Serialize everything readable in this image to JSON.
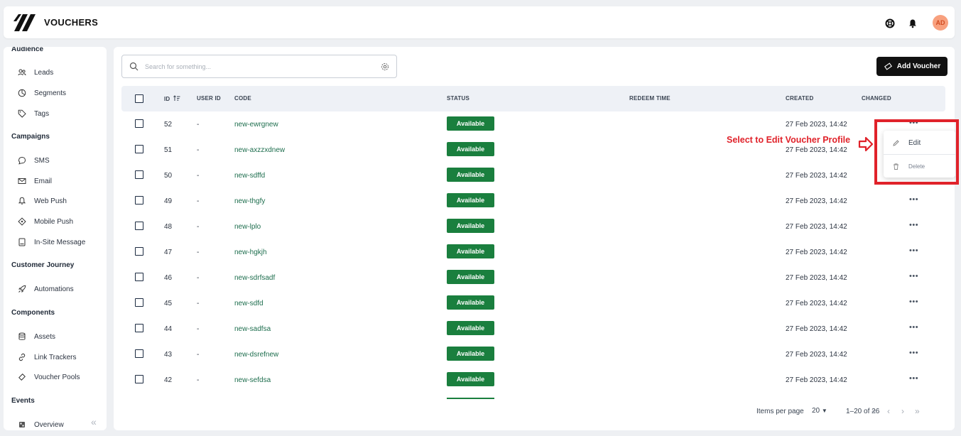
{
  "header": {
    "title": "VOUCHERS",
    "avatar_initials": "AD"
  },
  "sidebar": {
    "sections": [
      {
        "title": "Audience",
        "items": [
          "Leads",
          "Segments",
          "Tags"
        ]
      },
      {
        "title": "Campaigns",
        "items": [
          "SMS",
          "Email",
          "Web Push",
          "Mobile Push",
          "In-Site Message"
        ]
      },
      {
        "title": "Customer Journey",
        "items": [
          "Automations"
        ]
      },
      {
        "title": "Components",
        "items": [
          "Assets",
          "Link Trackers",
          "Voucher Pools"
        ]
      },
      {
        "title": "Events",
        "items": [
          "Overview"
        ]
      }
    ]
  },
  "search": {
    "placeholder": "Search for something..."
  },
  "toolbar": {
    "add_label": "Add Voucher"
  },
  "table": {
    "columns": {
      "id": "ID",
      "user_id": "USER ID",
      "code": "CODE",
      "status": "STATUS",
      "redeem_time": "REDEEM TIME",
      "created": "CREATED",
      "changed": "CHANGED"
    },
    "rows": [
      {
        "id": "52",
        "user_id": "-",
        "code": "new-ewrgnew",
        "status": "Available",
        "created": "27 Feb 2023, 14:42"
      },
      {
        "id": "51",
        "user_id": "-",
        "code": "new-axzzxdnew",
        "status": "Available",
        "created": "27 Feb 2023, 14:42"
      },
      {
        "id": "50",
        "user_id": "-",
        "code": "new-sdffd",
        "status": "Available",
        "created": "27 Feb 2023, 14:42"
      },
      {
        "id": "49",
        "user_id": "-",
        "code": "new-thgfy",
        "status": "Available",
        "created": "27 Feb 2023, 14:42"
      },
      {
        "id": "48",
        "user_id": "-",
        "code": "new-lplo",
        "status": "Available",
        "created": "27 Feb 2023, 14:42"
      },
      {
        "id": "47",
        "user_id": "-",
        "code": "new-hgkjh",
        "status": "Available",
        "created": "27 Feb 2023, 14:42"
      },
      {
        "id": "46",
        "user_id": "-",
        "code": "new-sdrfsadf",
        "status": "Available",
        "created": "27 Feb 2023, 14:42"
      },
      {
        "id": "45",
        "user_id": "-",
        "code": "new-sdfd",
        "status": "Available",
        "created": "27 Feb 2023, 14:42"
      },
      {
        "id": "44",
        "user_id": "-",
        "code": "new-sadfsa",
        "status": "Available",
        "created": "27 Feb 2023, 14:42"
      },
      {
        "id": "43",
        "user_id": "-",
        "code": "new-dsrefnew",
        "status": "Available",
        "created": "27 Feb 2023, 14:42"
      },
      {
        "id": "42",
        "user_id": "-",
        "code": "new-sefdsa",
        "status": "Available",
        "created": "27 Feb 2023, 14:42"
      }
    ]
  },
  "pagination": {
    "items_per_page_label": "Items per page",
    "per_page": "20",
    "range": "1–20 of 26"
  },
  "context_menu": {
    "edit": "Edit",
    "delete": "Delete"
  },
  "annotation": {
    "text": "Select to Edit Voucher Profile"
  },
  "colors": {
    "accent_green": "#1a7f3e",
    "highlight_red": "#e0222a",
    "button_dark": "#111111",
    "avatar_bg": "#f8a07e"
  }
}
